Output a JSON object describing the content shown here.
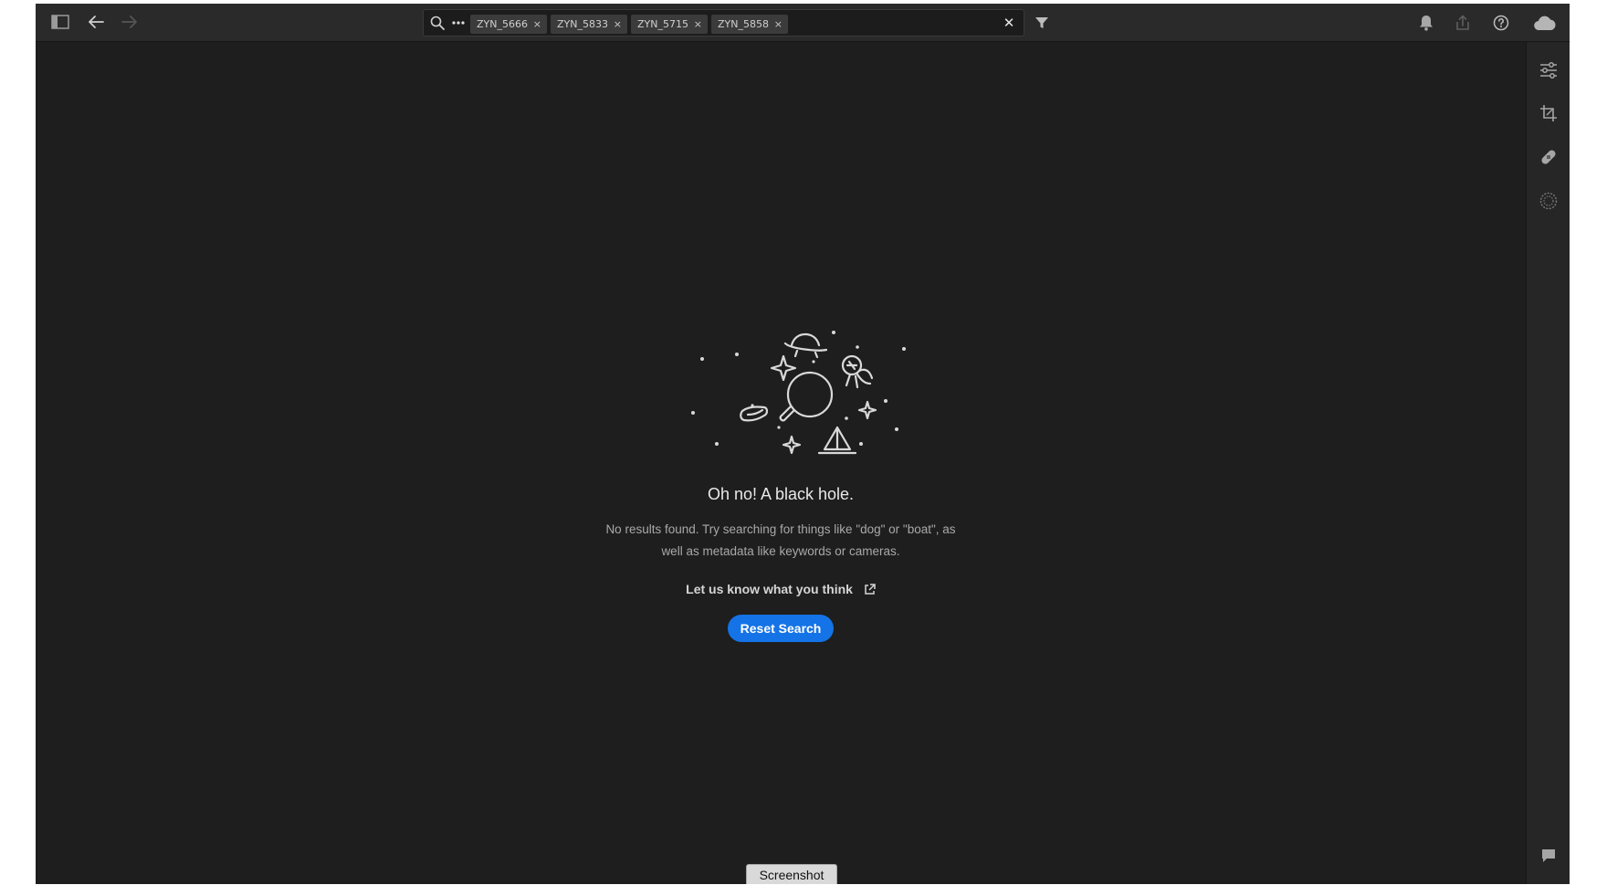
{
  "topbar": {
    "icons": {
      "sidebar": "sidebar-toggle-icon",
      "back": "arrow-left-icon",
      "forward": "arrow-right-icon",
      "filter": "filter-icon",
      "notifications": "bell-icon",
      "share": "share-icon",
      "help": "help-icon",
      "cloud": "cloud-icon"
    }
  },
  "search": {
    "chips": [
      {
        "label": "ZYN_5666",
        "remove": "×"
      },
      {
        "label": "ZYN_5833",
        "remove": "×"
      },
      {
        "label": "ZYN_5715",
        "remove": "×"
      },
      {
        "label": "ZYN_5858",
        "remove": "×"
      }
    ],
    "value": "",
    "clear": "✕"
  },
  "rightrail": {
    "icons": [
      "sliders-icon",
      "crop-icon",
      "bandage-icon",
      "masking-icon",
      "comment-icon"
    ]
  },
  "empty_state": {
    "title": "Oh no! A black hole.",
    "description": "No results found. Try searching for things like \"dog\" or \"boat\", as well as metadata like keywords or cameras.",
    "feedback_link": "Let us know what you think",
    "reset_button": "Reset Search"
  },
  "overlay": {
    "screenshot_label": "Screenshot"
  },
  "colors": {
    "accent": "#1473e6",
    "background": "#1e1e1e",
    "topbar": "#2a2a2a"
  }
}
